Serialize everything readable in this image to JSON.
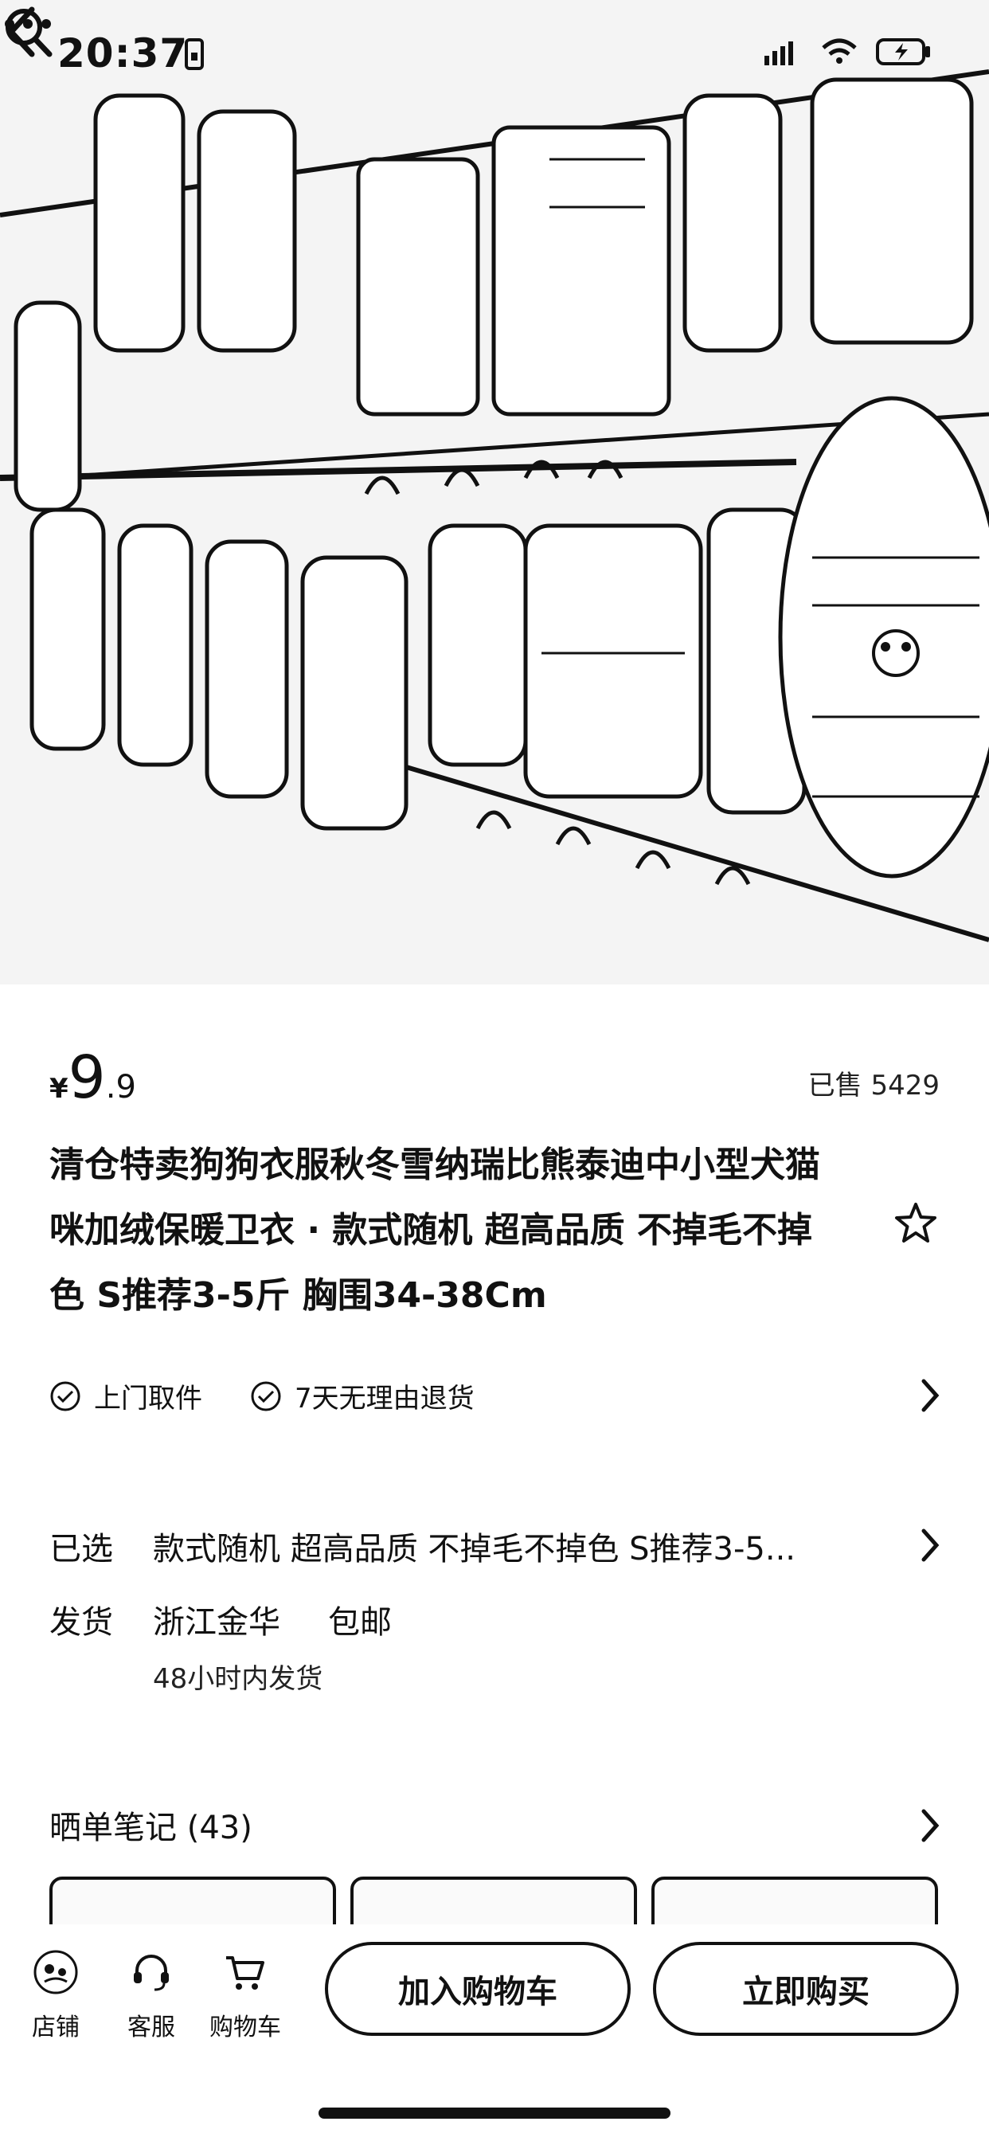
{
  "status_bar": {
    "time": "20:37"
  },
  "product": {
    "price_currency": "¥",
    "price_integer": "9",
    "price_decimal": ".9",
    "sold": "已售 5429",
    "title": "清仓特卖狗狗衣服秋冬雪纳瑞比熊泰迪中小型犬猫咪加绒保暖卫衣 · 款式随机 超高品质 不掉毛不掉色 S推荐3-5斤 胸围34-38Cm"
  },
  "services": [
    {
      "label": "上门取件",
      "icon": "check-circle-icon"
    },
    {
      "label": "7天无理由退货",
      "icon": "check-circle-icon"
    }
  ],
  "spec": {
    "selected_label": "已选",
    "selected_value": "款式随机 超高品质 不掉毛不掉色 S推荐3-5...",
    "shipping_label": "发货",
    "shipping_origin": "浙江金华",
    "shipping_fee": "包邮",
    "shipping_time": "48小时内发货"
  },
  "notes": {
    "title": "晒单笔记 (43)"
  },
  "bottom_bar": {
    "shop": "店铺",
    "service": "客服",
    "cart": "购物车",
    "add_to_cart": "加入购物车",
    "buy_now": "立即购买"
  }
}
